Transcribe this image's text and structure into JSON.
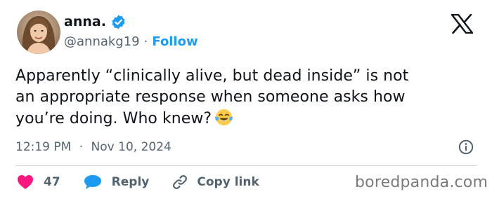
{
  "author": {
    "display_name": "anna.",
    "handle": "@annakg19",
    "separator": "·",
    "follow_label": "Follow"
  },
  "tweet": {
    "lines": [
      "Apparently “clinically alive, but dead inside” is not",
      "an appropriate response when someone asks how",
      "you’re doing. Who knew?"
    ],
    "emoji": "face-with-tears-of-joy"
  },
  "meta": {
    "time": "12:19 PM",
    "separator": "·",
    "date": "Nov 10, 2024"
  },
  "actions": {
    "like_count": "47",
    "reply_label": "Reply",
    "copy_link_label": "Copy link"
  },
  "watermark": "boredpanda.com",
  "colors": {
    "accent": "#1d9bf0",
    "like": "#f91880",
    "text": "#0f1419",
    "muted": "#536471",
    "divider": "#cfd9de"
  },
  "icons": [
    "avatar-photo",
    "verified-badge-icon",
    "x-logo-icon",
    "info-icon",
    "heart-icon",
    "reply-bubble-icon",
    "link-icon"
  ]
}
